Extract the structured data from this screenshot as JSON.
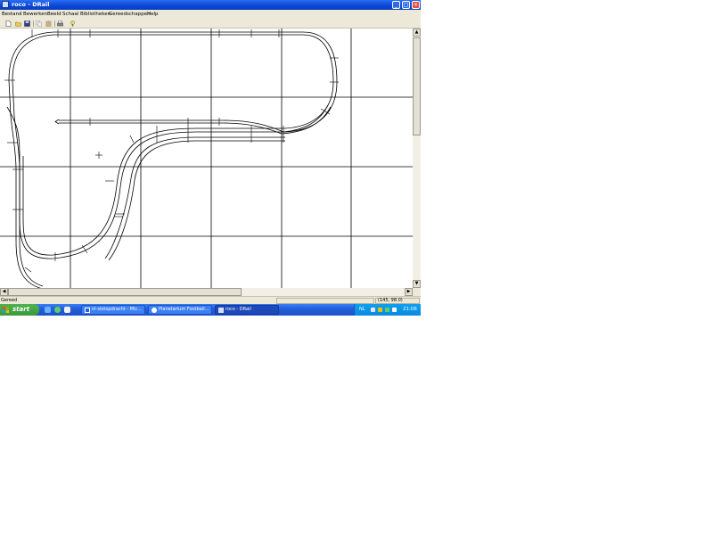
{
  "window": {
    "title": "roco - DRail",
    "minimize_glyph": "_",
    "maximize_glyph": "□",
    "close_glyph": "×"
  },
  "menu": [
    "Bestand",
    "Bewerken",
    "Beeld",
    "Schaal",
    "Bibliotheken",
    "Gereedschappen",
    "Help"
  ],
  "toolbar_icons": [
    "new-file-icon",
    "open-folder-icon",
    "save-icon",
    "copy-icon",
    "paste-icon",
    "print-icon",
    "info-icon"
  ],
  "scrollbars": {
    "up_arrow": "▲",
    "down_arrow": "▼",
    "left_arrow": "◀",
    "right_arrow": "▶"
  },
  "status": {
    "text": "Gereed",
    "coords": "(145, 98.0)"
  },
  "taskbar": {
    "start_label": "start",
    "quick_launch_icons": [
      "ie-icon",
      "media-icon",
      "outlook-icon"
    ],
    "tasks": [
      {
        "label": "nl-slotopdracht - Mic...",
        "active": false
      },
      {
        "label": "Planetarium Football...",
        "active": false
      },
      {
        "label": "roco - DRail",
        "active": true
      }
    ],
    "tray": {
      "language": "NL",
      "clock": "21:06"
    }
  },
  "colors": {
    "titlebar": "#0a46d6",
    "taskbar": "#245edb",
    "start_button": "#3b9a3b",
    "tray": "#0b8be0",
    "close_button": "#e0533a",
    "chrome": "#ece9d8"
  }
}
